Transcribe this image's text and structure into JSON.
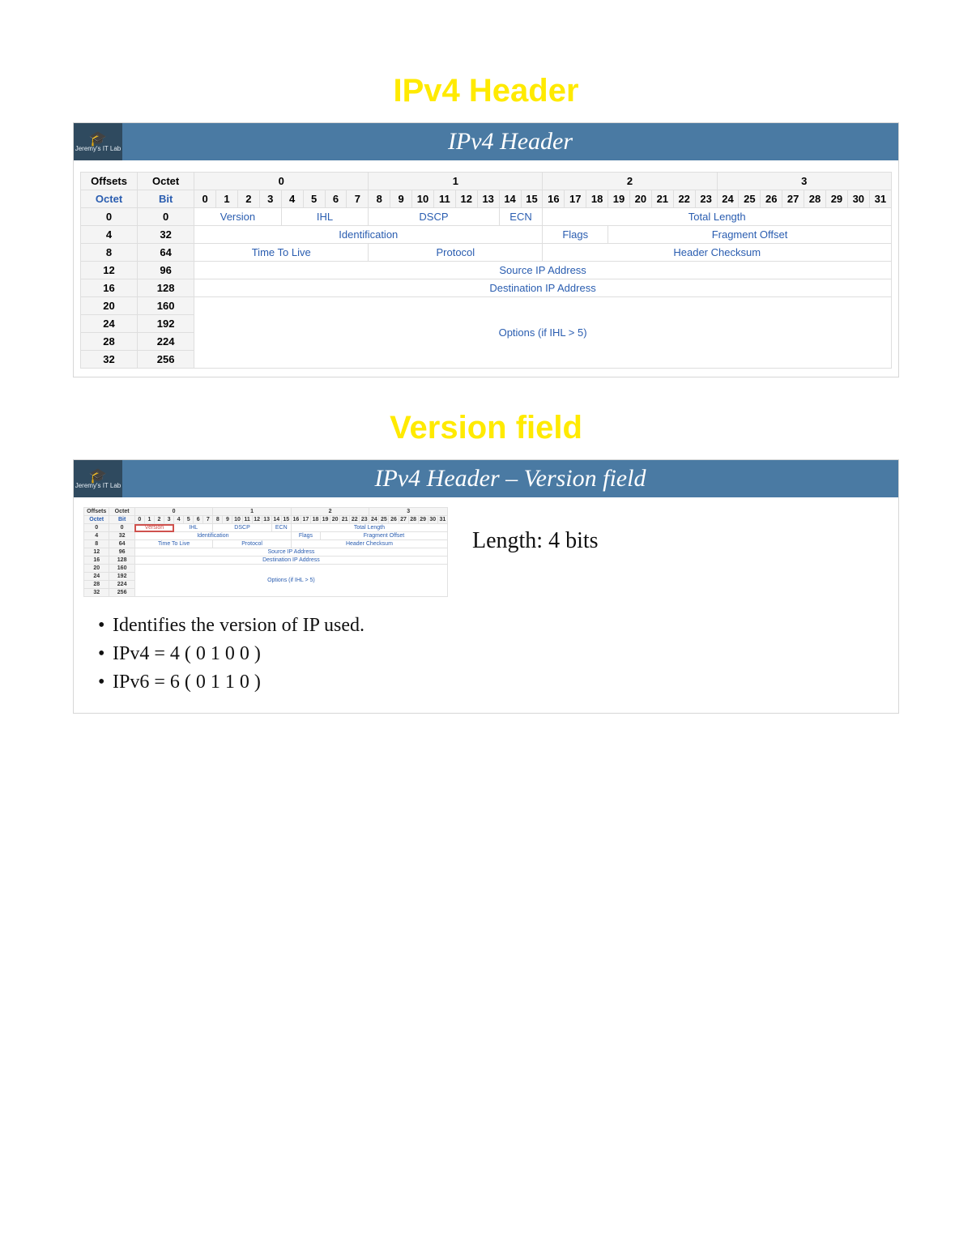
{
  "titles": {
    "t1": "IPv4 Header",
    "t2": "Version field"
  },
  "slideBars": {
    "s1": "IPv4 Header",
    "s2": "IPv4 Header – Version field"
  },
  "logo": {
    "sub": "Jeremy's IT Lab"
  },
  "headerTable": {
    "topHeaders": [
      "Offsets",
      "Octet"
    ],
    "octetGroups": [
      "0",
      "1",
      "2",
      "3"
    ],
    "secondRowLeft": [
      "Octet",
      "Bit"
    ],
    "bits": [
      "0",
      "1",
      "2",
      "3",
      "4",
      "5",
      "6",
      "7",
      "8",
      "9",
      "10",
      "11",
      "12",
      "13",
      "14",
      "15",
      "16",
      "17",
      "18",
      "19",
      "20",
      "21",
      "22",
      "23",
      "24",
      "25",
      "26",
      "27",
      "28",
      "29",
      "30",
      "31"
    ],
    "rows": [
      {
        "off": "0",
        "bit": "0",
        "cells": [
          {
            "t": "Version",
            "s": 4
          },
          {
            "t": "IHL",
            "s": 4
          },
          {
            "t": "DSCP",
            "s": 6
          },
          {
            "t": "ECN",
            "s": 2
          },
          {
            "t": "Total Length",
            "s": 16
          }
        ]
      },
      {
        "off": "4",
        "bit": "32",
        "cells": [
          {
            "t": "Identification",
            "s": 16
          },
          {
            "t": "Flags",
            "s": 3
          },
          {
            "t": "Fragment Offset",
            "s": 13
          }
        ]
      },
      {
        "off": "8",
        "bit": "64",
        "cells": [
          {
            "t": "Time To Live",
            "s": 8
          },
          {
            "t": "Protocol",
            "s": 8
          },
          {
            "t": "Header Checksum",
            "s": 16
          }
        ]
      },
      {
        "off": "12",
        "bit": "96",
        "cells": [
          {
            "t": "Source IP Address",
            "s": 32
          }
        ]
      },
      {
        "off": "16",
        "bit": "128",
        "cells": [
          {
            "t": "Destination IP Address",
            "s": 32
          }
        ]
      },
      {
        "off": "20",
        "bit": "160",
        "merge": "start",
        "cells": [
          {
            "t": "Options (if IHL > 5)",
            "s": 32,
            "rs": 4
          }
        ]
      },
      {
        "off": "24",
        "bit": "192",
        "merge": "cont"
      },
      {
        "off": "28",
        "bit": "224",
        "merge": "cont"
      },
      {
        "off": "32",
        "bit": "256",
        "merge": "cont"
      }
    ]
  },
  "lengthText": "Length: 4 bits",
  "bullets": [
    "Identifies the version of IP used.",
    "IPv4 = 4 ( 0 1 0 0 )",
    "IPv6 = 6 ( 0 1 1 0 )"
  ]
}
